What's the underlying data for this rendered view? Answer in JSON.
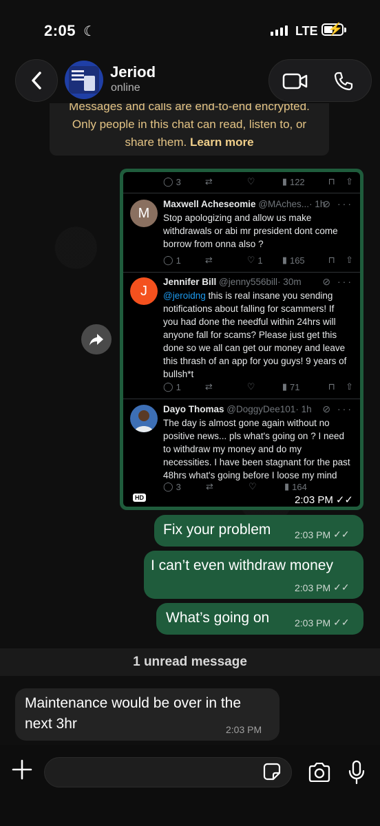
{
  "status_bar": {
    "time": "2:05",
    "network": "LTE"
  },
  "header": {
    "contact_name": "Jeriod",
    "contact_status": "online"
  },
  "encryption": {
    "text": "Messages and calls are end-to-end encrypted. Only people in this chat can read, listen to, or share them.",
    "learn_more": "Learn more"
  },
  "image_message": {
    "top_actions": {
      "replies": "3",
      "likes": "",
      "views": "122"
    },
    "tweets": [
      {
        "avatar_letter": "M",
        "name": "Maxwell Acheseomie",
        "handle": "@MAches...",
        "time": "· 1h",
        "body": "Stop apologizing and allow us make withdrawals or abi mr president dont come borrow from onna also ?",
        "replies": "1",
        "likes": "1",
        "views": "165"
      },
      {
        "avatar_letter": "J",
        "name": "Jennifer Bill",
        "handle": "@jenny556bill",
        "time": "· 30m",
        "mention": "@jeroidng",
        "body": " this is real insane you sending notifications about falling for scammers! If you had done the needful within 24hrs will anyone fall for scams? Please just get this done so we all can get our money and leave this thrash of an app for you guys! 9 years of bullsh*t",
        "replies": "1",
        "likes": "",
        "views": "71"
      },
      {
        "avatar_letter": "",
        "name": "Dayo Thomas",
        "handle": "@DoggyDee101",
        "time": "· 1h",
        "body": "The day is almost gone again without no positive news... pls what's going on ? I need to withdraw my money and do my necessities. I have been stagnant for the past 48hrs what's going before I loose my mind",
        "replies": "3",
        "likes": "",
        "views": "164"
      }
    ],
    "hd_label": "HD",
    "time": "2:03 PM"
  },
  "messages": [
    {
      "text": "Fix your problem",
      "time": "2:03 PM",
      "direction": "out"
    },
    {
      "text": "I can’t even withdraw money",
      "time": "2:03 PM",
      "direction": "out"
    },
    {
      "text": "What’s going on",
      "time": "2:03 PM",
      "direction": "out"
    }
  ],
  "unread_divider": "1 unread message",
  "incoming": {
    "text_line1": "Maintenance would be over in the",
    "text_line2": "next 3hr",
    "time": "2:03 PM"
  },
  "composer": {
    "placeholder": ""
  },
  "colors": {
    "outgoing_bubble": "#1f5c3c",
    "incoming_bubble": "#232323",
    "encryption_text": "#e4c485",
    "mention": "#1d9bf0"
  }
}
